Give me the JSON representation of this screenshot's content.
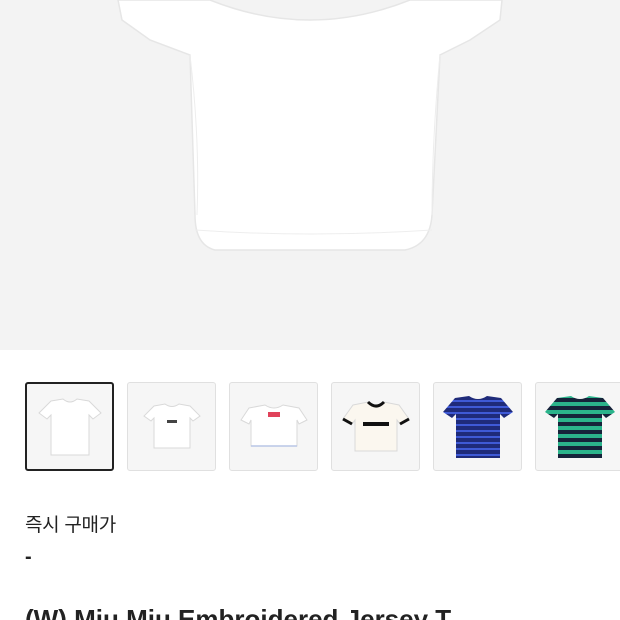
{
  "product": {
    "main_image_icon": "white-tshirt-image",
    "thumbnails": [
      {
        "name": "white-tshirt",
        "selected": true
      },
      {
        "name": "white-logo-tshirt",
        "selected": false
      },
      {
        "name": "white-pink-logo-crop-tshirt",
        "selected": false
      },
      {
        "name": "white-miumiu-ringer-tshirt",
        "selected": false
      },
      {
        "name": "navy-stripe-tshirt",
        "selected": false
      },
      {
        "name": "green-stripe-tshirt",
        "selected": false
      }
    ],
    "price_label": "즉시 구매가",
    "price_value": "-",
    "title": "(W) Miu Miu Embroidered Jersey T"
  },
  "colors": {
    "background": "#ffffff",
    "hero_background": "#f3f3f3",
    "text": "#222222",
    "selected_border": "#222222",
    "thumb_border": "#e0e0e0"
  }
}
